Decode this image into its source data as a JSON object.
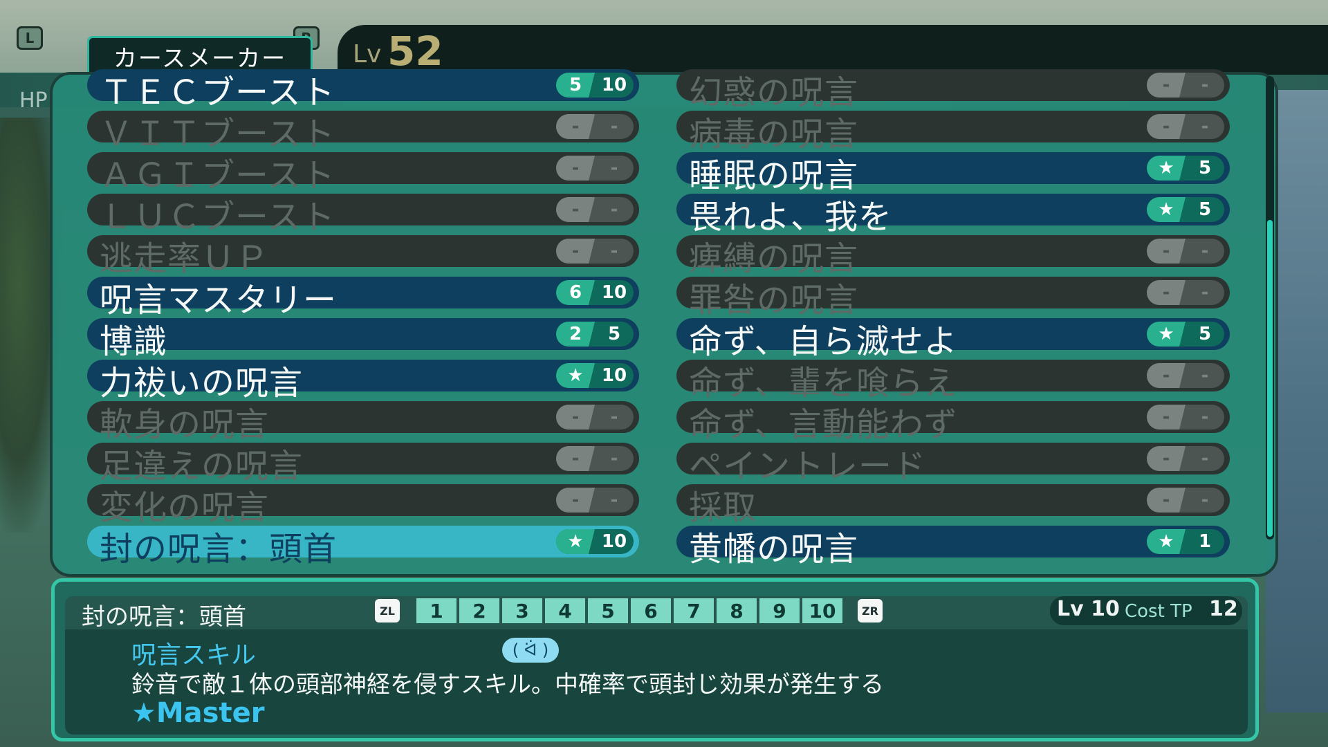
{
  "header": {
    "l_button": "L",
    "r_button": "R",
    "class_name": "カースメーカー",
    "level_prefix": "Lv",
    "level_value": "52",
    "hp_label": "HP"
  },
  "skills_left": [
    {
      "name": "ＴＥＣブースト",
      "state": "on",
      "a": "5",
      "b": "10"
    },
    {
      "name": "ＶＩＴブースト",
      "state": "off",
      "a": "-",
      "b": "-"
    },
    {
      "name": "ＡＧＩブースト",
      "state": "off",
      "a": "-",
      "b": "-"
    },
    {
      "name": "ＬＵＣブースト",
      "state": "off",
      "a": "-",
      "b": "-"
    },
    {
      "name": "逃走率ＵＰ",
      "state": "off",
      "a": "-",
      "b": "-"
    },
    {
      "name": "呪言マスタリー",
      "state": "on",
      "a": "6",
      "b": "10"
    },
    {
      "name": "博識",
      "state": "on",
      "a": "2",
      "b": "5"
    },
    {
      "name": "力祓いの呪言",
      "state": "on",
      "a": "★",
      "b": "10"
    },
    {
      "name": "軟身の呪言",
      "state": "off",
      "a": "-",
      "b": "-"
    },
    {
      "name": "足違えの呪言",
      "state": "off",
      "a": "-",
      "b": "-"
    },
    {
      "name": "変化の呪言",
      "state": "off",
      "a": "-",
      "b": "-"
    },
    {
      "name": "封の呪言：頭首",
      "state": "sel",
      "a": "★",
      "b": "10"
    }
  ],
  "skills_right": [
    {
      "name": "幻惑の呪言",
      "state": "off",
      "a": "-",
      "b": "-"
    },
    {
      "name": "病毒の呪言",
      "state": "off",
      "a": "-",
      "b": "-"
    },
    {
      "name": "睡眠の呪言",
      "state": "on",
      "a": "★",
      "b": "5"
    },
    {
      "name": "畏れよ、我を",
      "state": "on",
      "a": "★",
      "b": "5"
    },
    {
      "name": "痺縛の呪言",
      "state": "off",
      "a": "-",
      "b": "-"
    },
    {
      "name": "罪咎の呪言",
      "state": "off",
      "a": "-",
      "b": "-"
    },
    {
      "name": "命ず、自ら滅せよ",
      "state": "on",
      "a": "★",
      "b": "5"
    },
    {
      "name": "命ず、輩を喰らえ",
      "state": "off",
      "a": "-",
      "b": "-"
    },
    {
      "name": "命ず、言動能わず",
      "state": "off",
      "a": "-",
      "b": "-"
    },
    {
      "name": "ペイントレード",
      "state": "off",
      "a": "-",
      "b": "-"
    },
    {
      "name": "採取",
      "state": "off",
      "a": "-",
      "b": "-"
    },
    {
      "name": "黄幡の呪言",
      "state": "on",
      "a": "★",
      "b": "1"
    }
  ],
  "detail": {
    "title": "封の呪言：頭首",
    "zl": "ZL",
    "zr": "ZR",
    "levels": [
      "1",
      "2",
      "3",
      "4",
      "5",
      "6",
      "7",
      "8",
      "9",
      "10"
    ],
    "lv_label": "Lv 10",
    "cost_label": "Cost TP",
    "cost_value": "12",
    "type": "呪言スキル",
    "description": "鈴音で敵１体の頭部神経を侵すスキル。中確率で頭封じ効果が発生する",
    "master": "★Master",
    "type_icon": "face-icon"
  },
  "colors": {
    "panel": "#268c7a",
    "skill_on": "#0e3f5e",
    "skill_off": "#2c3431",
    "skill_selected": "#38b6c6",
    "accent": "#34c7a7"
  }
}
